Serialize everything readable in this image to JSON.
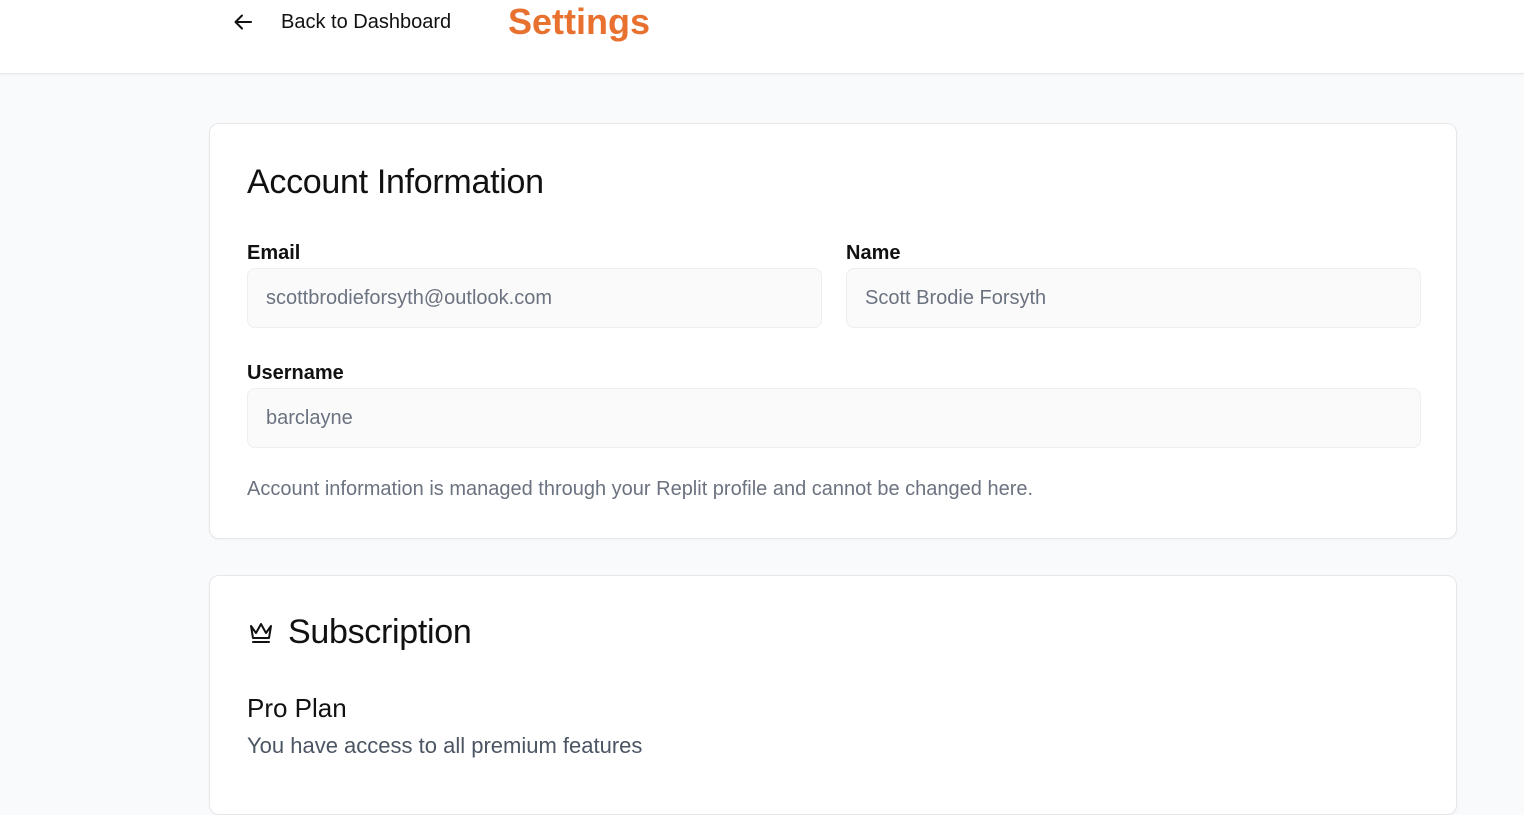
{
  "header": {
    "back_label": "Back to Dashboard",
    "back_icon": "arrow-left-icon",
    "title": "Settings",
    "title_color": "#e8712f"
  },
  "account": {
    "heading": "Account Information",
    "email": {
      "label": "Email",
      "value": "scottbrodieforsyth@outlook.com"
    },
    "name": {
      "label": "Name",
      "value": "Scott Brodie Forsyth"
    },
    "username": {
      "label": "Username",
      "value": "barclayne"
    },
    "help": "Account information is managed through your Replit profile and cannot be changed here."
  },
  "subscription": {
    "icon": "crown-icon",
    "heading": "Subscription",
    "plan_name": "Pro Plan",
    "plan_desc": "You have access to all premium features"
  }
}
